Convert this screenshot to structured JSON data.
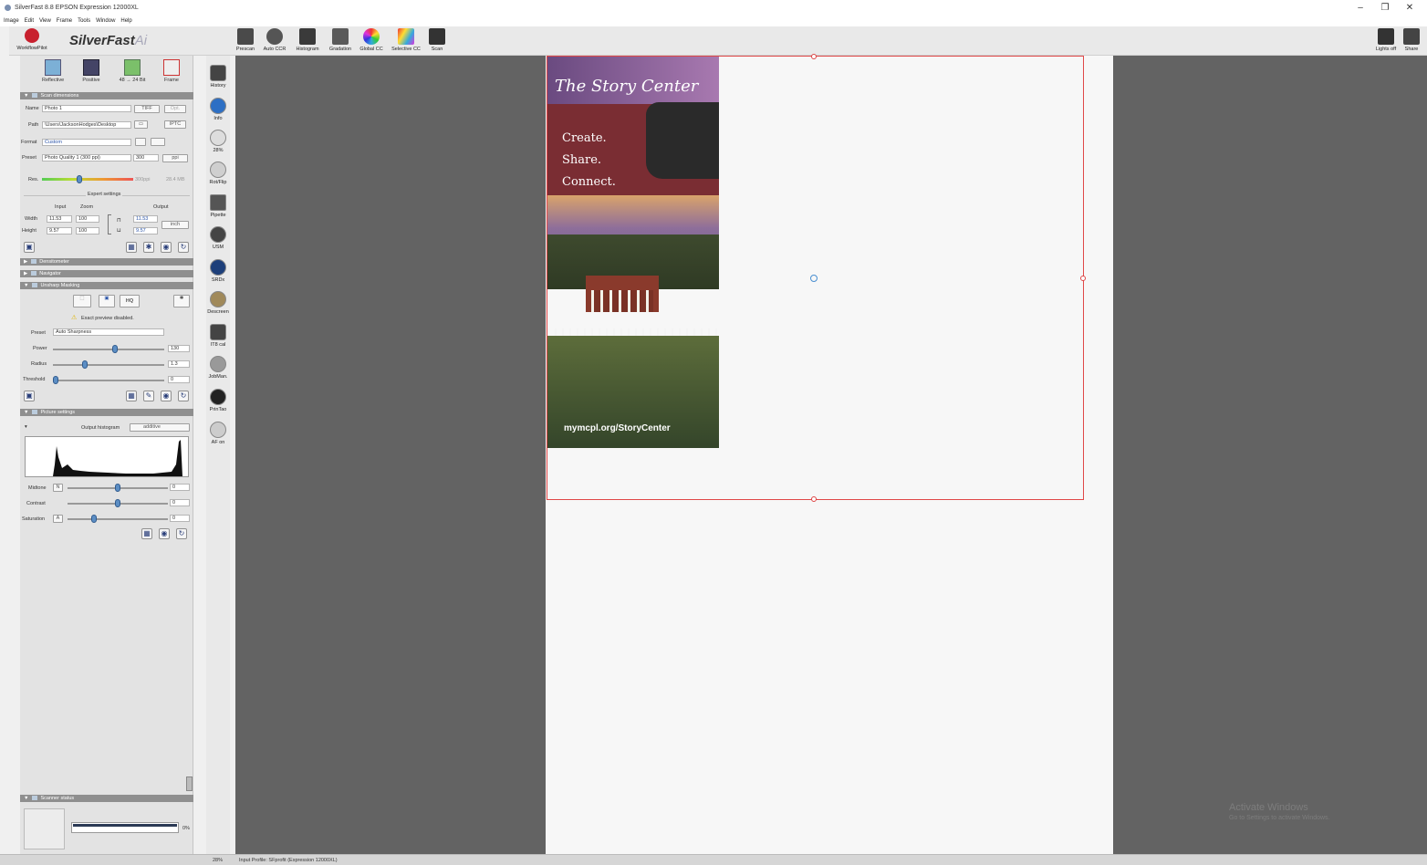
{
  "window": {
    "title": "SilverFast 8.8 EPSON Expression 12000XL",
    "menu": [
      "Image",
      "Edit",
      "View",
      "Frame",
      "Tools",
      "Window",
      "Help"
    ],
    "controls": [
      "–",
      "❐",
      "✕"
    ]
  },
  "header": {
    "workflow_label": "WorkflowPilot",
    "logo": "SilverFast",
    "logo_suffix": "Ai"
  },
  "mode_buttons": [
    {
      "label": "Reflective",
      "icon": "reflective-icon"
    },
    {
      "label": "Positive",
      "icon": "positive-film-icon"
    },
    {
      "label": "48 → 24 Bit",
      "icon": "bitdepth-icon"
    },
    {
      "label": "Frame",
      "icon": "frame-icon"
    }
  ],
  "toolbar": {
    "buttons": [
      "Prescan",
      "Auto CCR",
      "Histogram",
      "Gradation",
      "Global CC",
      "Selective CC",
      "Scan"
    ],
    "right": [
      "Lights off",
      "Share"
    ]
  },
  "scan_dimensions": {
    "title": "Scan dimensions",
    "name_label": "Name",
    "name_value": "Photo 1",
    "format_value": "TIFF",
    "opt_label": "Opt.",
    "path_label": "Path",
    "path_value": "\\Users\\JacksonHodges\\Desktop",
    "iptc_label": "IPTC",
    "format_label": "Format",
    "format_select": "Custom",
    "preset_label": "Preset",
    "preset_value": "Photo Quality 1 (300 ppi)",
    "preset_num": "300",
    "preset_unit": "ppi",
    "res_label": "Res.",
    "res_value": "300ppi",
    "res_size": "28.4 MB",
    "expert_label": "Expert settings",
    "input_label": "Input",
    "zoom_label": "Zoom",
    "output_label": "Output",
    "width_label": "Width",
    "width_in": "11.53",
    "width_zoom": "100",
    "width_out": "11.53",
    "height_label": "Height",
    "height_in": "9.57",
    "height_zoom": "100",
    "height_out": "9.57",
    "unit": "inch"
  },
  "densitometer": {
    "title": "Densitometer"
  },
  "navigator": {
    "title": "Navigator"
  },
  "usm": {
    "title": "Unsharp Masking",
    "hq_label": "HQ",
    "warning": "Exact preview disabled.",
    "preset_label": "Preset",
    "preset_value": "Auto Sharpness",
    "power_label": "Power",
    "power_value": "130",
    "power_pos": 0.56,
    "radius_label": "Radius",
    "radius_value": "1.3",
    "radius_pos": 0.28,
    "threshold_label": "Threshold",
    "threshold_value": "0",
    "threshold_pos": 0.0
  },
  "picture": {
    "title": "Picture settings",
    "hist_label": "Output histogram",
    "hist_mode": "additive",
    "midtone_label": "Midtone",
    "midtone_badge": "N",
    "midtone_value": "0",
    "midtone_pos": 0.5,
    "contrast_label": "Contrast",
    "contrast_value": "0",
    "contrast_pos": 0.5,
    "saturation_label": "Saturation",
    "saturation_badge": "A",
    "saturation_value": "0",
    "saturation_pos": 0.25
  },
  "scanner_status": {
    "title": "Scanner status",
    "progress": "0%"
  },
  "tools": [
    {
      "label": "History",
      "icon": "history-icon"
    },
    {
      "label": "Info",
      "icon": "info-icon"
    },
    {
      "label": "28%",
      "icon": "zoom-icon"
    },
    {
      "label": "Rot/Flip",
      "icon": "rotate-flip-icon"
    },
    {
      "label": "Pipette",
      "icon": "pipette-icon"
    },
    {
      "label": "USM",
      "icon": "usm-icon"
    },
    {
      "label": "SRDx",
      "icon": "srdx-icon"
    },
    {
      "label": "Descreen",
      "icon": "descreen-icon"
    },
    {
      "label": "IT8 cal",
      "icon": "it8-icon"
    },
    {
      "label": "JobMan.",
      "icon": "jobmanager-icon"
    },
    {
      "label": "PrinTao",
      "icon": "printao-icon"
    },
    {
      "label": "AF on",
      "icon": "autofocus-icon"
    }
  ],
  "brochure": {
    "logo": "The Story Center",
    "lines": [
      "Create.",
      "Share.",
      "Connect."
    ],
    "url": "mymcpl.org/StoryCenter"
  },
  "watermark": {
    "title": "Activate Windows",
    "sub": "Go to Settings to activate Windows."
  },
  "status_bar": {
    "zoom": "28%",
    "profile": "Input Profile: SFprofit (Expression 12000XL)"
  }
}
